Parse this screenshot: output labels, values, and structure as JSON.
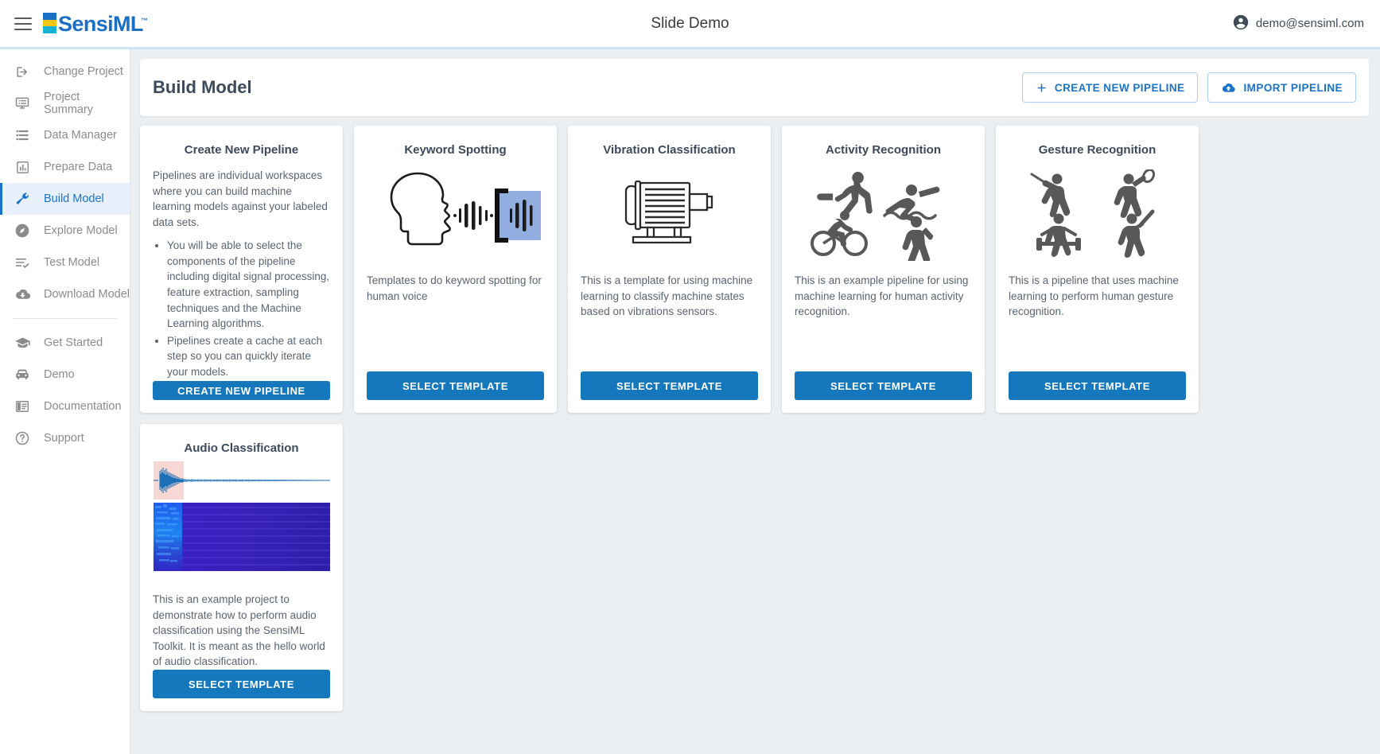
{
  "header": {
    "menu_icon": "hamburger-menu-icon",
    "logo_text": "SensiML",
    "logo_tm": "™",
    "app_title": "Slide Demo",
    "account_icon": "account-circle-icon",
    "account_email": "demo@sensiml.com"
  },
  "colors": {
    "brand_blue": "#1a6fc4",
    "accent_blue": "#1578bd",
    "active_nav_bg": "#e8f1fb",
    "logo_yellow": "#f5c518",
    "logo_cyan": "#16b2d6",
    "page_bg": "#eceff1"
  },
  "sidebar": {
    "items": [
      {
        "label": "Change Project",
        "icon": "login-arrow-icon",
        "active": false
      },
      {
        "label": "Project Summary",
        "icon": "project-summary-icon",
        "active": false
      },
      {
        "label": "Data Manager",
        "icon": "storage-icon",
        "active": false
      },
      {
        "label": "Prepare Data",
        "icon": "bar-chart-icon",
        "active": false
      },
      {
        "label": "Build Model",
        "icon": "wrench-icon",
        "active": true
      },
      {
        "label": "Explore Model",
        "icon": "compass-icon",
        "active": false
      },
      {
        "label": "Test Model",
        "icon": "checklist-icon",
        "active": false
      },
      {
        "label": "Download Model",
        "icon": "cloud-download-icon",
        "active": false
      }
    ],
    "secondary_items": [
      {
        "label": "Get Started",
        "icon": "graduation-cap-icon"
      },
      {
        "label": "Demo",
        "icon": "car-icon"
      },
      {
        "label": "Documentation",
        "icon": "book-icon"
      },
      {
        "label": "Support",
        "icon": "help-circle-icon"
      }
    ]
  },
  "page": {
    "title": "Build Model",
    "create_pipeline_button": "CREATE NEW PIPELINE",
    "create_pipeline_icon": "plus-icon",
    "import_pipeline_button": "IMPORT PIPELINE",
    "import_pipeline_icon": "cloud-upload-icon"
  },
  "cards": [
    {
      "id": "create-new-pipeline",
      "title": "Create New Pipeline",
      "art": "none",
      "description": "Pipelines are individual workspaces where you can build machine learning models against your labeled data sets.",
      "bullets": [
        "You will be able to select the components of the pipeline including digital signal processing, feature extraction, sampling techniques and the Machine Learning algorithms.",
        "Pipelines create a cache at each step so you can quickly iterate your models."
      ],
      "button": "CREATE NEW PIPELINE"
    },
    {
      "id": "keyword-spotting",
      "title": "Keyword Spotting",
      "art": "head-soundwave-illustration",
      "description": "Templates to do keyword spotting for human voice",
      "button": "SELECT TEMPLATE"
    },
    {
      "id": "vibration-classification",
      "title": "Vibration Classification",
      "art": "electric-motor-illustration",
      "description": "This is a template for using machine learning to classify machine states based on vibrations sensors.",
      "button": "SELECT TEMPLATE"
    },
    {
      "id": "activity-recognition",
      "title": "Activity Recognition",
      "art": "activity-pictograms-illustration",
      "description": "This is an example pipeline for using machine learning for human activity recognition.",
      "button": "SELECT TEMPLATE"
    },
    {
      "id": "gesture-recognition",
      "title": "Gesture Recognition",
      "art": "sports-gesture-pictograms-illustration",
      "description": "This is a pipeline that uses machine learning to perform human gesture recognition.",
      "button": "SELECT TEMPLATE"
    },
    {
      "id": "audio-classification",
      "title": "Audio Classification",
      "art": "waveform-spectrogram-illustration",
      "description": "This is an example project to demonstrate how to perform audio classification using the SensiML Toolkit. It is meant as the hello world of audio classification.",
      "button": "SELECT TEMPLATE"
    }
  ]
}
